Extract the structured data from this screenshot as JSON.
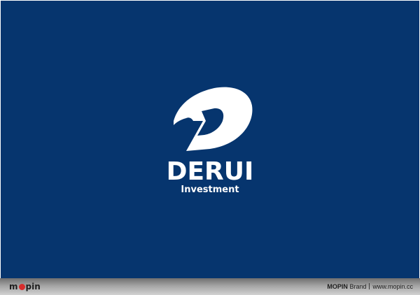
{
  "logo": {
    "wordmark": "DERUI",
    "tagline": "Investment",
    "emblem_icon": "stylized-d-emblem-icon"
  },
  "footer": {
    "logo_left": "m",
    "logo_right": "pin",
    "brand_name": "MOPIN",
    "brand_suffix": "Brand",
    "url": "www.mopin.cc"
  },
  "colors": {
    "background": "#06356e",
    "logo": "#ffffff",
    "footer_accent": "#d62d2d"
  }
}
